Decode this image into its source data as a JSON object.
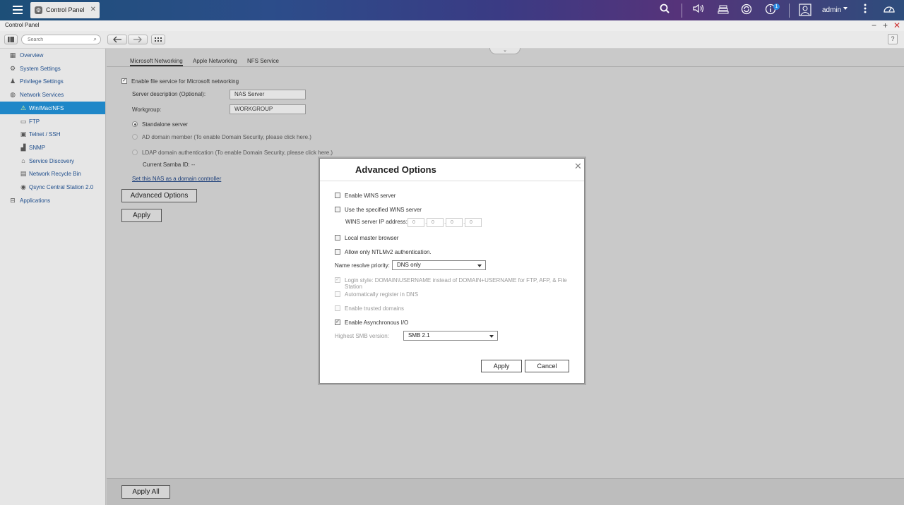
{
  "topbar": {
    "app_tab_label": "Control Panel",
    "notification_count": "1",
    "user_name": "admin"
  },
  "window": {
    "title": "Control Panel"
  },
  "toolbar": {
    "search_placeholder": "Search",
    "help_label": "?"
  },
  "sidebar": {
    "items": [
      {
        "label": "Overview",
        "icon": "overview-icon"
      },
      {
        "label": "System Settings",
        "icon": "gear-icon"
      },
      {
        "label": "Privilege Settings",
        "icon": "user-icon"
      },
      {
        "label": "Network Services",
        "icon": "globe-icon"
      },
      {
        "label": "Win/Mac/NFS",
        "icon": "network-icon",
        "selected": true
      },
      {
        "label": "FTP",
        "icon": "folder-icon"
      },
      {
        "label": "Telnet / SSH",
        "icon": "terminal-icon"
      },
      {
        "label": "SNMP",
        "icon": "chart-icon"
      },
      {
        "label": "Service Discovery",
        "icon": "discovery-icon"
      },
      {
        "label": "Network Recycle Bin",
        "icon": "recycle-icon"
      },
      {
        "label": "Qsync Central Station 2.0",
        "icon": "sync-icon"
      },
      {
        "label": "Applications",
        "icon": "apps-icon"
      }
    ]
  },
  "main": {
    "tabs": [
      "Microsoft Networking",
      "Apple Networking",
      "NFS Service"
    ],
    "active_tab": "Microsoft Networking",
    "enable_label": "Enable file service for Microsoft networking",
    "server_desc_label": "Server description (Optional):",
    "server_desc_value": "NAS Server",
    "workgroup_label": "Workgroup:",
    "workgroup_value": "WORKGROUP",
    "standalone_label": "Standalone server",
    "ad_label": "AD domain member (To enable Domain Security, please click here.)",
    "ldap_label": "LDAP domain authentication (To enable Domain Security, please click here.)",
    "samba_id_label": "Current Samba ID: --",
    "domain_controller_link": "Set this NAS as a domain controller",
    "advanced_button": "Advanced Options",
    "apply_button": "Apply",
    "apply_all_button": "Apply All"
  },
  "dialog": {
    "title": "Advanced Options",
    "enable_wins": "Enable WINS server",
    "use_wins": "Use the specified WINS server",
    "wins_ip_label": "WINS server IP address:",
    "wins_ip": [
      "0",
      "0",
      "0",
      "0"
    ],
    "local_master": "Local master browser",
    "ntlmv2": "Allow only NTLMv2 authentication.",
    "name_resolve_label": "Name resolve priority:",
    "name_resolve_value": "DNS only",
    "login_style": "Login style: DOMAIN\\USERNAME instead of DOMAIN+USERNAME for FTP, AFP, & File Station",
    "auto_register": "Automatically register in DNS",
    "trusted_domains": "Enable trusted domains",
    "async_io": "Enable Asynchronous I/O",
    "smb_label": "Highest SMB version:",
    "smb_value": "SMB 2.1",
    "apply_button": "Apply",
    "cancel_button": "Cancel"
  }
}
